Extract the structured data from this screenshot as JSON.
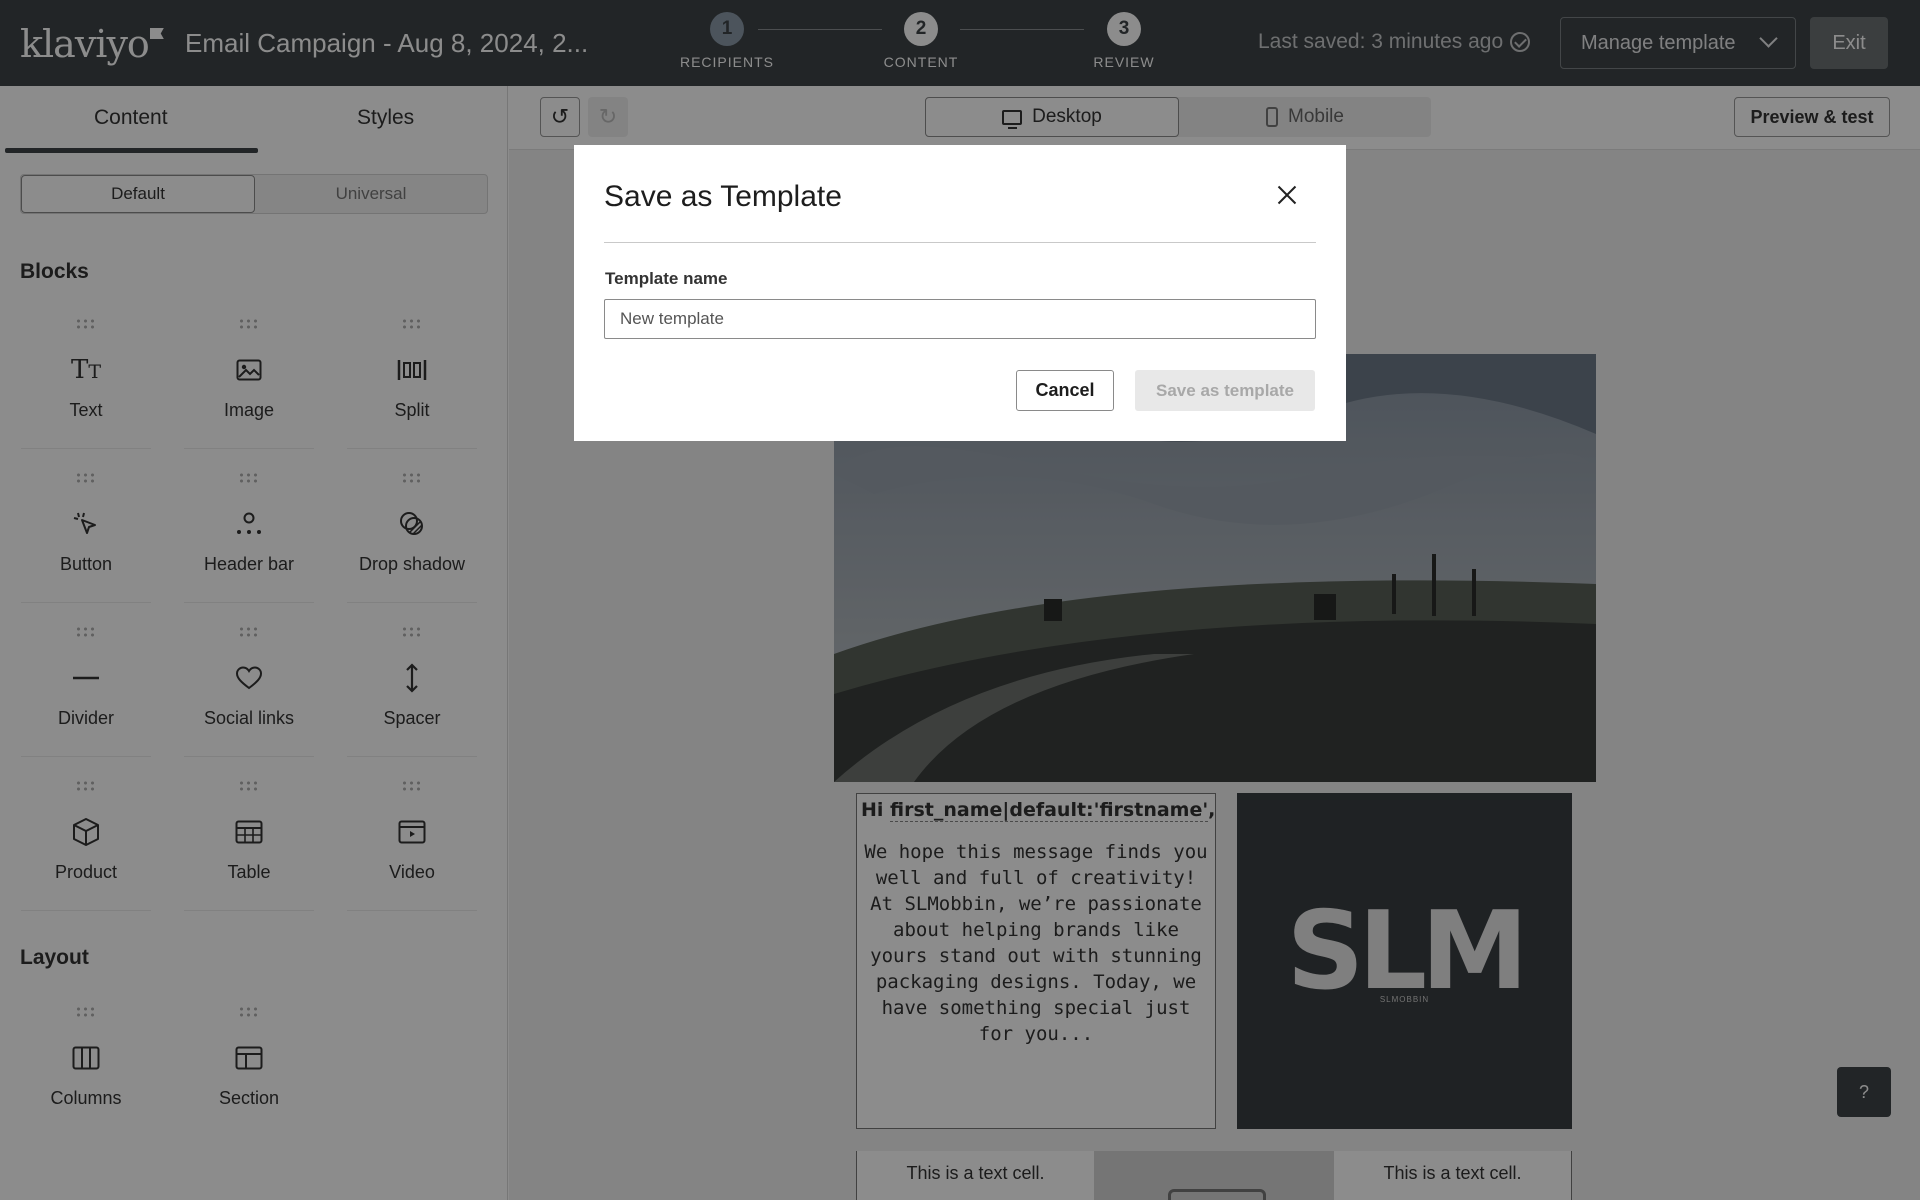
{
  "header": {
    "logo_text": "klaviyo",
    "campaign_title": "Email Campaign - Aug 8, 2024, 2...",
    "steps": [
      {
        "number": "1",
        "label": "RECIPIENTS"
      },
      {
        "number": "2",
        "label": "CONTENT"
      },
      {
        "number": "3",
        "label": "REVIEW"
      }
    ],
    "last_saved": "Last saved: 3 minutes ago",
    "manage_template": "Manage template",
    "exit": "Exit"
  },
  "sidebar": {
    "tabs": [
      "Content",
      "Styles"
    ],
    "segments": [
      "Default",
      "Universal"
    ],
    "blocks_heading": "Blocks",
    "blocks": [
      {
        "label": "Text",
        "icon": "text-icon"
      },
      {
        "label": "Image",
        "icon": "image-icon"
      },
      {
        "label": "Split",
        "icon": "split-icon"
      },
      {
        "label": "Button",
        "icon": "cursor-icon"
      },
      {
        "label": "Header bar",
        "icon": "header-bar-icon"
      },
      {
        "label": "Drop shadow",
        "icon": "drop-shadow-icon"
      },
      {
        "label": "Divider",
        "icon": "divider-icon"
      },
      {
        "label": "Social links",
        "icon": "heart-icon"
      },
      {
        "label": "Spacer",
        "icon": "spacer-icon"
      },
      {
        "label": "Product",
        "icon": "box-icon"
      },
      {
        "label": "Table",
        "icon": "table-icon"
      },
      {
        "label": "Video",
        "icon": "video-icon"
      }
    ],
    "layout_heading": "Layout",
    "layout_blocks": [
      {
        "label": "Columns",
        "icon": "columns-icon"
      },
      {
        "label": "Section",
        "icon": "section-icon"
      }
    ]
  },
  "toolbar": {
    "desktop": "Desktop",
    "mobile": "Mobile",
    "preview": "Preview & test"
  },
  "email": {
    "greeting_prefix": "Hi",
    "greeting_tag": "first_name|default:'firstname'",
    "greeting_suffix": ",",
    "body": "We hope this message finds you well and full of creativity! At SLMobbin, we’re passionate about helping brands like yours stand out with stunning packaging designs. Today, we have something special just for you...",
    "logo_text": "SLM",
    "logo_sub": "SLMOBBIN",
    "cell_left": "This is a text cell.",
    "cell_right": "This is a text cell.",
    "help": "?"
  },
  "modal": {
    "title": "Save as Template",
    "field_label": "Template name",
    "field_placeholder": "New template",
    "cancel": "Cancel",
    "save": "Save as template"
  },
  "colors": {
    "topbar": "#3e4447",
    "overlay": "rgba(0,0,0,0.45)"
  }
}
